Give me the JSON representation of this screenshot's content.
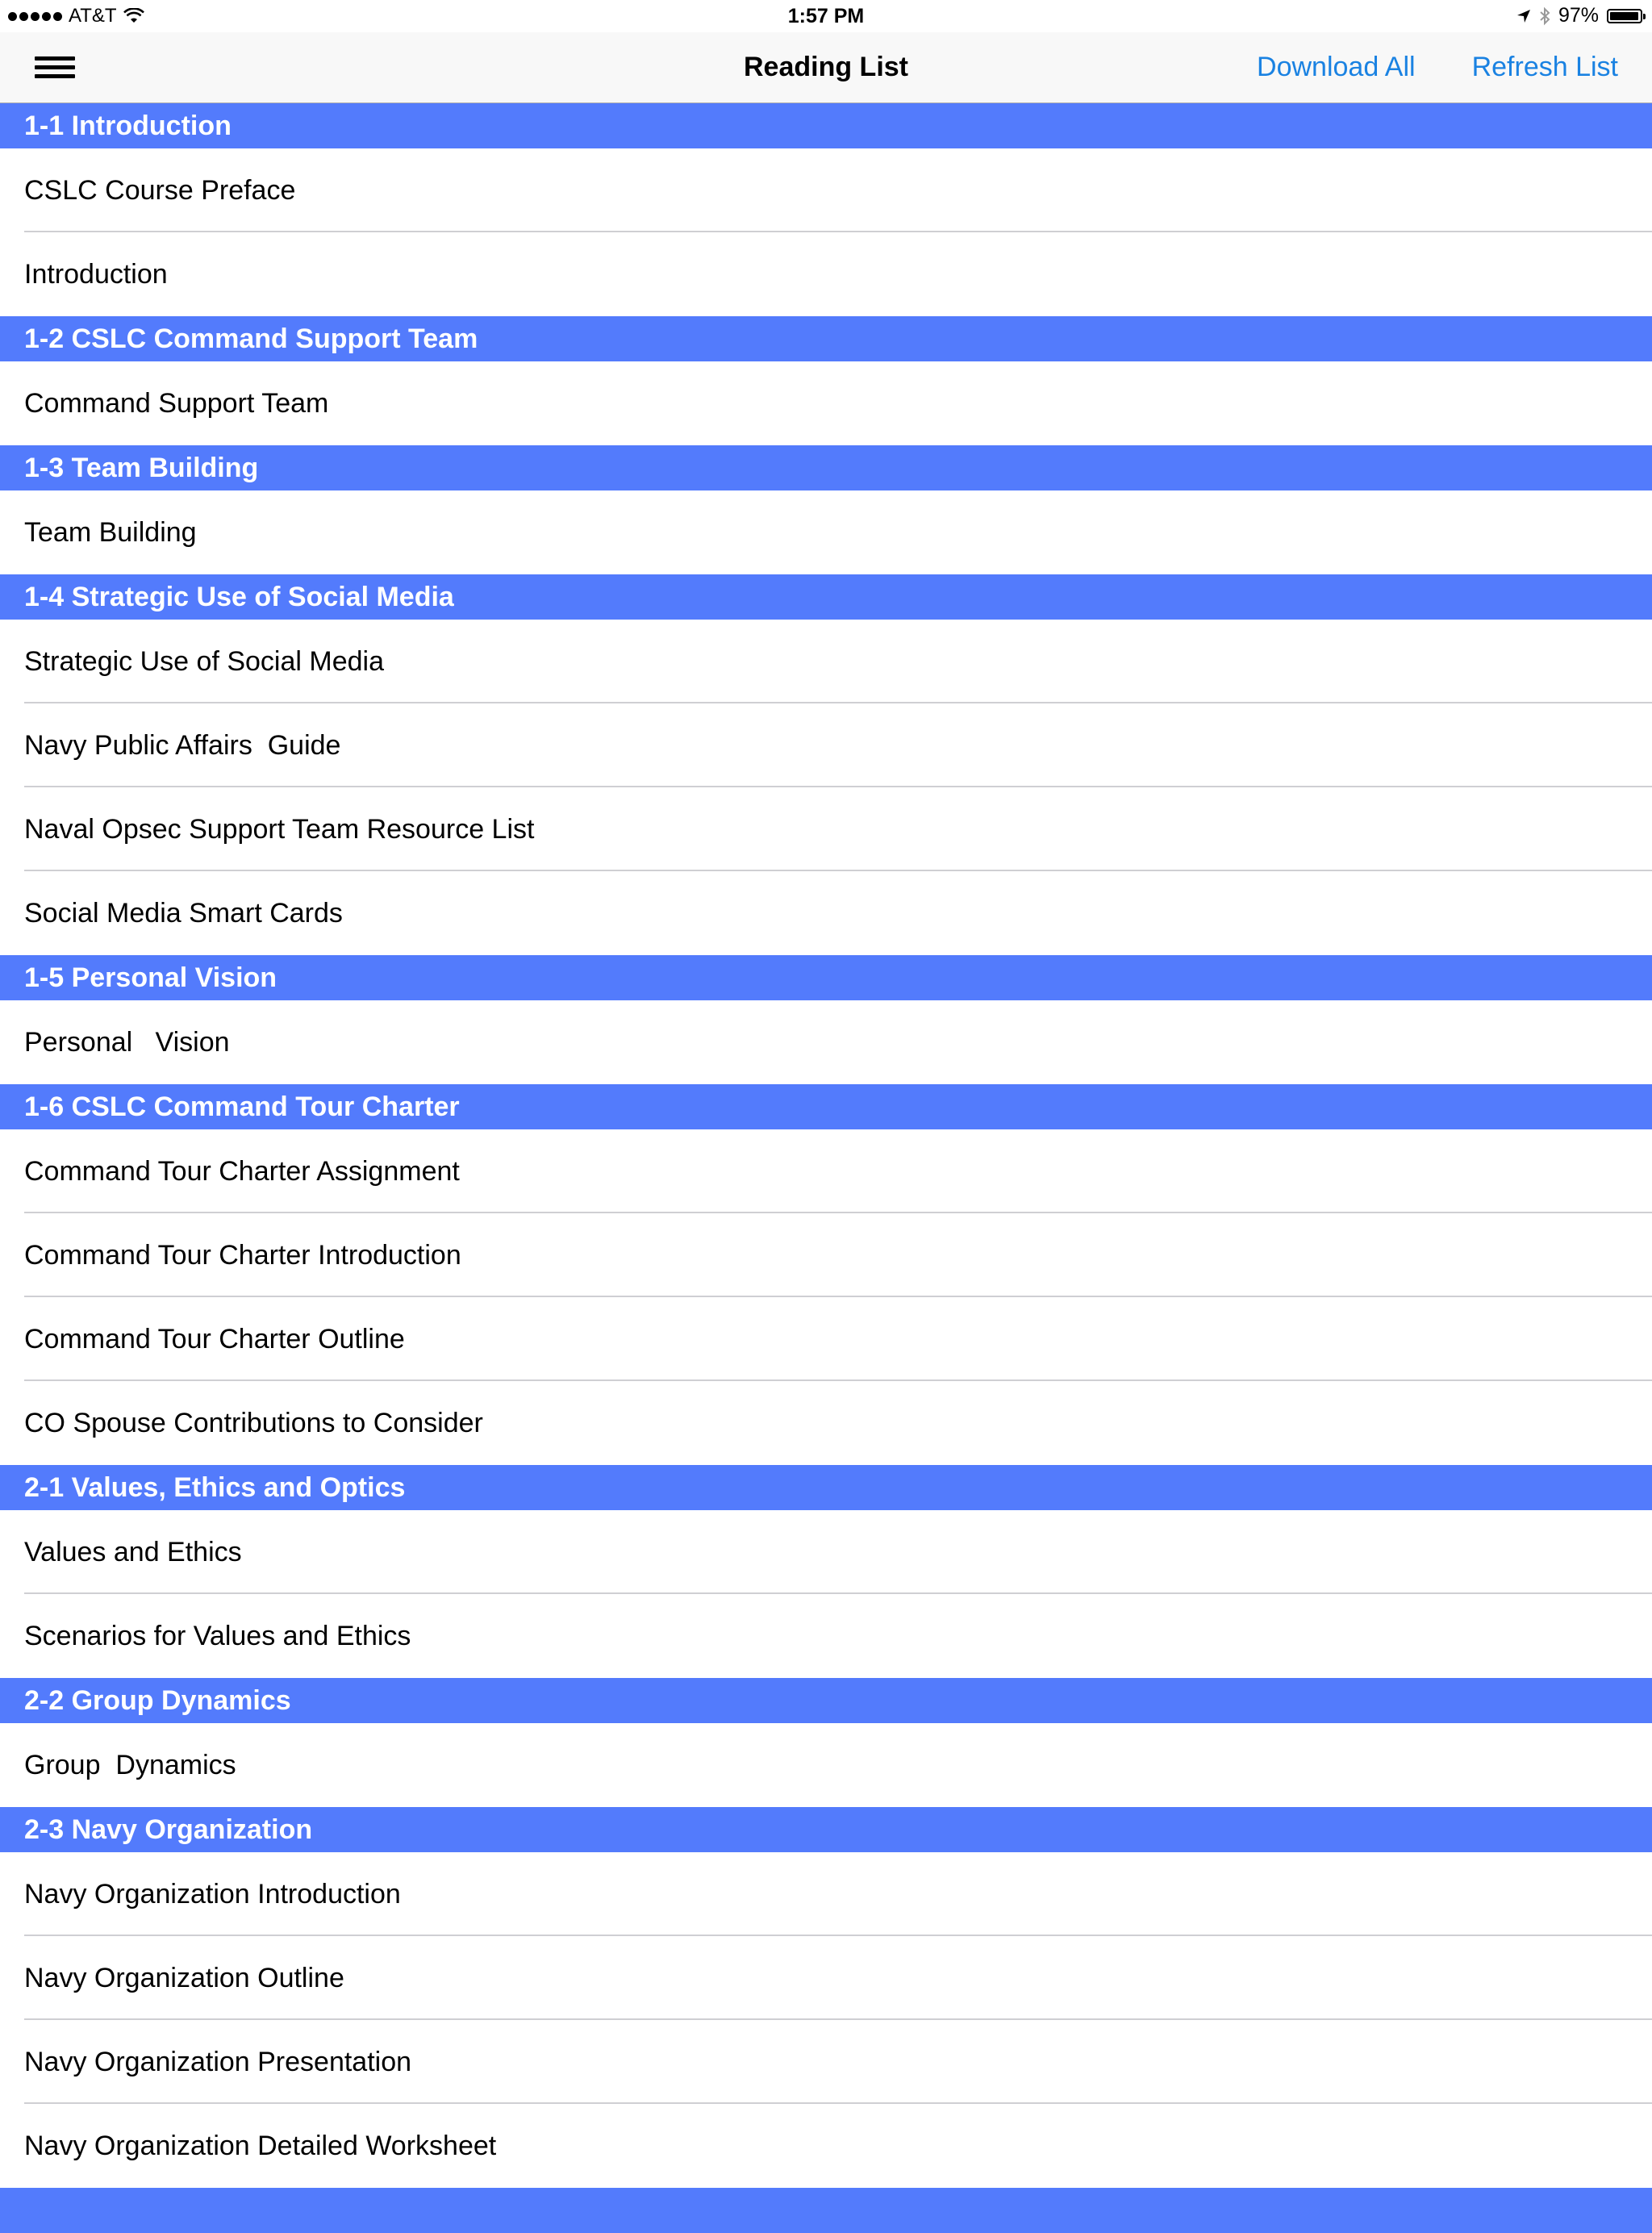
{
  "status_bar": {
    "carrier": "AT&T",
    "time": "1:57 PM",
    "battery_percent": "97%",
    "battery_level": 0.97
  },
  "nav": {
    "title": "Reading List",
    "download_all": "Download All",
    "refresh_list": "Refresh List"
  },
  "colors": {
    "section_header": "#537bfc",
    "link": "#1a82e2"
  },
  "sections": [
    {
      "title": "1-1 Introduction",
      "items": [
        "CSLC Course Preface",
        "Introduction"
      ]
    },
    {
      "title": "1-2 CSLC Command Support Team",
      "items": [
        "Command Support Team"
      ]
    },
    {
      "title": "1-3 Team Building",
      "items": [
        "Team Building"
      ]
    },
    {
      "title": "1-4 Strategic Use of Social Media",
      "items": [
        "Strategic Use of Social Media",
        "Navy Public Affairs  Guide",
        "Naval Opsec Support Team Resource List",
        "Social Media Smart Cards"
      ]
    },
    {
      "title": "1-5 Personal Vision",
      "items": [
        "Personal   Vision"
      ]
    },
    {
      "title": "1-6 CSLC Command Tour Charter",
      "items": [
        "Command Tour Charter Assignment",
        "Command Tour Charter Introduction",
        "Command Tour Charter Outline",
        "CO Spouse Contributions to Consider"
      ]
    },
    {
      "title": "2-1 Values, Ethics and Optics",
      "items": [
        "Values and Ethics",
        "Scenarios for Values and Ethics"
      ]
    },
    {
      "title": "2-2 Group Dynamics",
      "items": [
        "Group  Dynamics"
      ]
    },
    {
      "title": "2-3 Navy Organization",
      "items": [
        "Navy Organization Introduction",
        "Navy Organization Outline",
        "Navy Organization Presentation",
        "Navy Organization Detailed Worksheet"
      ]
    },
    {
      "title": "",
      "items": []
    }
  ]
}
